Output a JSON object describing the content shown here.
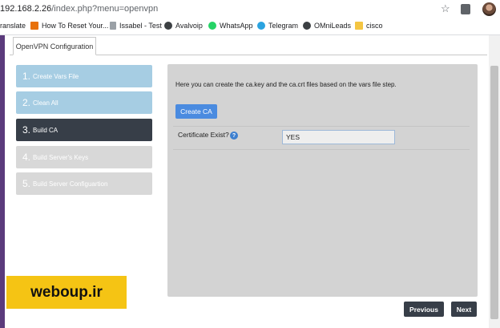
{
  "browser": {
    "url_host": "192.168.2.26",
    "url_path": "/index.php?menu=openvpn",
    "star_icon": "star-icon",
    "extension_icon": "extension-icon",
    "profile_icon": "avatar"
  },
  "bookmarks": [
    {
      "label": "ranslate",
      "icon": "none"
    },
    {
      "label": "How To Reset Your...",
      "icon": "bookmark-favicon",
      "color": "#e8710a"
    },
    {
      "label": "Issabel - Test",
      "icon": "issabel-icon",
      "color": "#9aa0a6"
    },
    {
      "label": "Avalvoip",
      "icon": "globe-icon",
      "color": "#3c4043"
    },
    {
      "label": "WhatsApp",
      "icon": "whatsapp-icon",
      "color": "#25d366"
    },
    {
      "label": "Telegram",
      "icon": "telegram-icon",
      "color": "#2aa3e0"
    },
    {
      "label": "OMniLeads",
      "icon": "globe-icon",
      "color": "#3c4043"
    },
    {
      "label": "cisco",
      "icon": "folder-icon",
      "color": "#f4c542"
    }
  ],
  "tab": {
    "label": "OpenVPN Configuration"
  },
  "steps": [
    {
      "num": "1.",
      "label": "Create Vars File",
      "state": "done"
    },
    {
      "num": "2.",
      "label": "Clean All",
      "state": "done"
    },
    {
      "num": "3.",
      "label": "Build CA",
      "state": "active"
    },
    {
      "num": "4.",
      "label": "Build Server's Keys",
      "state": "todo"
    },
    {
      "num": "5.",
      "label": "Build Server Configuartion",
      "state": "todo"
    }
  ],
  "content": {
    "description": "Here you can create the ca.key and the ca.crt files based on the vars file step.",
    "create_ca_label": "Create CA",
    "cert_label": "Certificate Exist?",
    "cert_value": "YES",
    "help_icon": "help-icon"
  },
  "nav": {
    "previous_label": "Previous",
    "next_label": "Next"
  },
  "watermark": {
    "text": "weboup.ir"
  },
  "colors": {
    "accent": "#4a8be0",
    "step_done": "#a6cde3",
    "step_active": "#373e48",
    "step_todo": "#d8d8d8",
    "watermark": "#f5c414"
  }
}
